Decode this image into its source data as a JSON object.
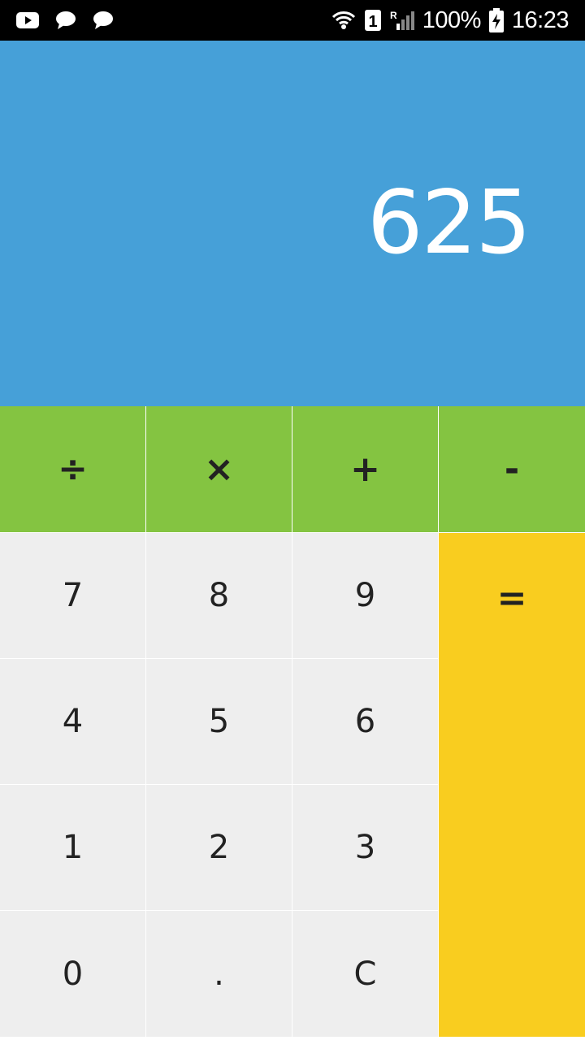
{
  "status_bar": {
    "left_icons": [
      "youtube-icon",
      "chat-bubble-icon",
      "chat-bubble-icon"
    ],
    "sim_slot": "1",
    "battery_percent": "100%",
    "time": "16:23"
  },
  "display": {
    "value": "625"
  },
  "operators": {
    "divide": "÷",
    "multiply": "×",
    "plus": "+",
    "minus": "-"
  },
  "keys": {
    "seven": "7",
    "eight": "8",
    "nine": "9",
    "four": "4",
    "five": "5",
    "six": "6",
    "one": "1",
    "two": "2",
    "three": "3",
    "zero": "0",
    "dot": ".",
    "clear": "C",
    "equals": "="
  },
  "colors": {
    "display_bg": "#46a0d8",
    "operator_bg": "#84c441",
    "number_bg": "#eeeeee",
    "equals_bg": "#f9cd1f"
  }
}
